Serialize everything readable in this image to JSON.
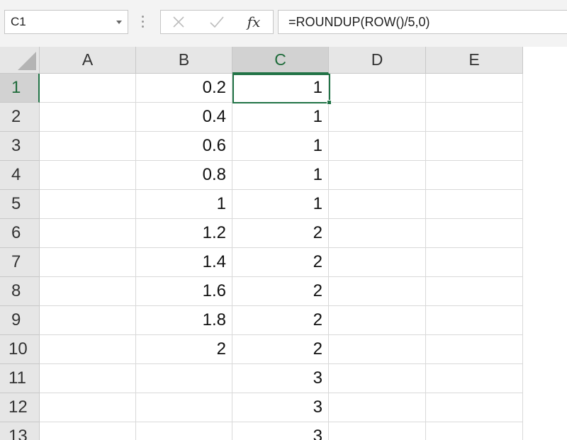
{
  "name_box": {
    "value": "C1"
  },
  "formula_bar": {
    "cancel_icon": "cancel-x-icon",
    "enter_icon": "checkmark-icon",
    "insert_function_label": "fx",
    "formula": "=ROUNDUP(ROW()/5,0)"
  },
  "columns": [
    "A",
    "B",
    "C",
    "D",
    "E"
  ],
  "selected_column": "C",
  "rows": [
    {
      "num": "1",
      "a": "",
      "b": "0.2",
      "c": "1",
      "d": "",
      "e": ""
    },
    {
      "num": "2",
      "a": "",
      "b": "0.4",
      "c": "1",
      "d": "",
      "e": ""
    },
    {
      "num": "3",
      "a": "",
      "b": "0.6",
      "c": "1",
      "d": "",
      "e": ""
    },
    {
      "num": "4",
      "a": "",
      "b": "0.8",
      "c": "1",
      "d": "",
      "e": ""
    },
    {
      "num": "5",
      "a": "",
      "b": "1",
      "c": "1",
      "d": "",
      "e": ""
    },
    {
      "num": "6",
      "a": "",
      "b": "1.2",
      "c": "2",
      "d": "",
      "e": ""
    },
    {
      "num": "7",
      "a": "",
      "b": "1.4",
      "c": "2",
      "d": "",
      "e": ""
    },
    {
      "num": "8",
      "a": "",
      "b": "1.6",
      "c": "2",
      "d": "",
      "e": ""
    },
    {
      "num": "9",
      "a": "",
      "b": "1.8",
      "c": "2",
      "d": "",
      "e": ""
    },
    {
      "num": "10",
      "a": "",
      "b": "2",
      "c": "2",
      "d": "",
      "e": ""
    },
    {
      "num": "11",
      "a": "",
      "b": "",
      "c": "3",
      "d": "",
      "e": ""
    },
    {
      "num": "12",
      "a": "",
      "b": "",
      "c": "3",
      "d": "",
      "e": ""
    },
    {
      "num": "13",
      "a": "",
      "b": "",
      "c": "3",
      "d": "",
      "e": ""
    }
  ],
  "selected_row": "1",
  "colors": {
    "selection": "#217346",
    "header_bg": "#e6e6e6",
    "selected_header_bg": "#d2d2d2"
  }
}
